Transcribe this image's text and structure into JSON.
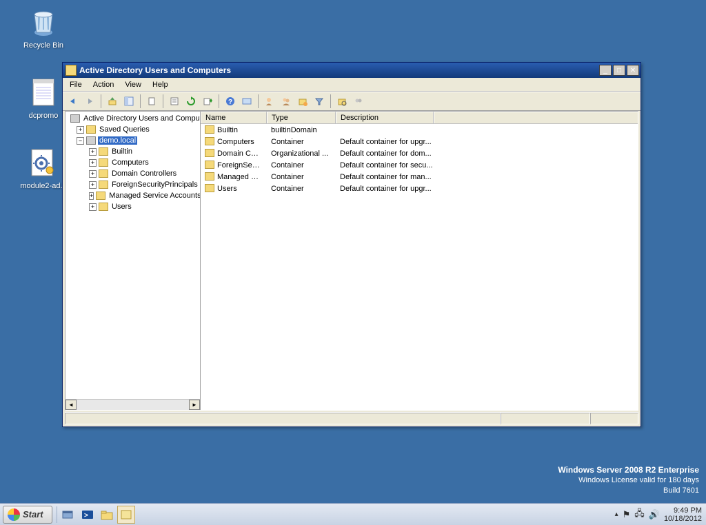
{
  "desktop_icons": [
    {
      "label": "Recycle Bin"
    },
    {
      "label": "dcpromo"
    },
    {
      "label": "module2-ad..."
    }
  ],
  "watermark": {
    "l1": "Windows Server 2008 R2 Enterprise",
    "l2": "Windows License valid for 180 days",
    "l3": "Build 7601"
  },
  "window": {
    "title": "Active Directory Users and Computers",
    "menus": [
      "File",
      "Action",
      "View",
      "Help"
    ],
    "tree": {
      "root": "Active Directory Users and Comput",
      "saved_queries": "Saved Queries",
      "domain": "demo.local",
      "children": [
        "Builtin",
        "Computers",
        "Domain Controllers",
        "ForeignSecurityPrincipals",
        "Managed Service Accounts",
        "Users"
      ]
    },
    "columns": {
      "name": "Name",
      "type": "Type",
      "desc": "Description"
    },
    "col_widths": {
      "name": 96,
      "type": 100,
      "desc": 142
    },
    "list_icon": "folder",
    "rows": [
      {
        "name": "Builtin",
        "type": "builtinDomain",
        "desc": ""
      },
      {
        "name": "Computers",
        "type": "Container",
        "desc": "Default container for upgr..."
      },
      {
        "name": "Domain Cont...",
        "type": "Organizational ...",
        "desc": "Default container for dom..."
      },
      {
        "name": "ForeignSecur...",
        "type": "Container",
        "desc": "Default container for secu..."
      },
      {
        "name": "Managed Ser...",
        "type": "Container",
        "desc": "Default container for man..."
      },
      {
        "name": "Users",
        "type": "Container",
        "desc": "Default container for upgr..."
      }
    ]
  },
  "taskbar": {
    "start": "Start",
    "time": "9:49 PM",
    "date": "10/18/2012"
  }
}
